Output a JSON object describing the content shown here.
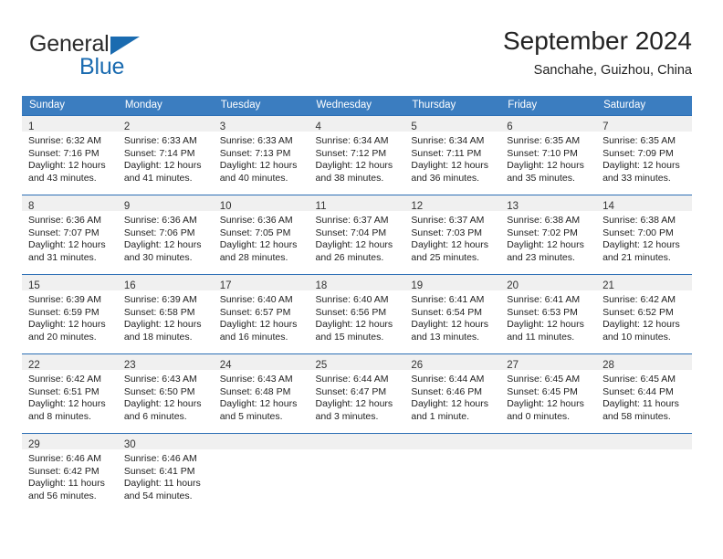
{
  "brand": {
    "name_top": "General",
    "name_bottom": "Blue",
    "accent_color": "#1a6bb0"
  },
  "header": {
    "title": "September 2024",
    "subtitle": "Sanchahe, Guizhou, China"
  },
  "calendar": {
    "header_bg": "#3b7dc0",
    "row_line_color": "#2c6fb5",
    "daynum_bg": "#f0f0f0",
    "weekday_headers": [
      "Sunday",
      "Monday",
      "Tuesday",
      "Wednesday",
      "Thursday",
      "Friday",
      "Saturday"
    ],
    "weeks": [
      [
        {
          "day": "1",
          "lines": [
            "Sunrise: 6:32 AM",
            "Sunset: 7:16 PM",
            "Daylight: 12 hours",
            "and 43 minutes."
          ]
        },
        {
          "day": "2",
          "lines": [
            "Sunrise: 6:33 AM",
            "Sunset: 7:14 PM",
            "Daylight: 12 hours",
            "and 41 minutes."
          ]
        },
        {
          "day": "3",
          "lines": [
            "Sunrise: 6:33 AM",
            "Sunset: 7:13 PM",
            "Daylight: 12 hours",
            "and 40 minutes."
          ]
        },
        {
          "day": "4",
          "lines": [
            "Sunrise: 6:34 AM",
            "Sunset: 7:12 PM",
            "Daylight: 12 hours",
            "and 38 minutes."
          ]
        },
        {
          "day": "5",
          "lines": [
            "Sunrise: 6:34 AM",
            "Sunset: 7:11 PM",
            "Daylight: 12 hours",
            "and 36 minutes."
          ]
        },
        {
          "day": "6",
          "lines": [
            "Sunrise: 6:35 AM",
            "Sunset: 7:10 PM",
            "Daylight: 12 hours",
            "and 35 minutes."
          ]
        },
        {
          "day": "7",
          "lines": [
            "Sunrise: 6:35 AM",
            "Sunset: 7:09 PM",
            "Daylight: 12 hours",
            "and 33 minutes."
          ]
        }
      ],
      [
        {
          "day": "8",
          "lines": [
            "Sunrise: 6:36 AM",
            "Sunset: 7:07 PM",
            "Daylight: 12 hours",
            "and 31 minutes."
          ]
        },
        {
          "day": "9",
          "lines": [
            "Sunrise: 6:36 AM",
            "Sunset: 7:06 PM",
            "Daylight: 12 hours",
            "and 30 minutes."
          ]
        },
        {
          "day": "10",
          "lines": [
            "Sunrise: 6:36 AM",
            "Sunset: 7:05 PM",
            "Daylight: 12 hours",
            "and 28 minutes."
          ]
        },
        {
          "day": "11",
          "lines": [
            "Sunrise: 6:37 AM",
            "Sunset: 7:04 PM",
            "Daylight: 12 hours",
            "and 26 minutes."
          ]
        },
        {
          "day": "12",
          "lines": [
            "Sunrise: 6:37 AM",
            "Sunset: 7:03 PM",
            "Daylight: 12 hours",
            "and 25 minutes."
          ]
        },
        {
          "day": "13",
          "lines": [
            "Sunrise: 6:38 AM",
            "Sunset: 7:02 PM",
            "Daylight: 12 hours",
            "and 23 minutes."
          ]
        },
        {
          "day": "14",
          "lines": [
            "Sunrise: 6:38 AM",
            "Sunset: 7:00 PM",
            "Daylight: 12 hours",
            "and 21 minutes."
          ]
        }
      ],
      [
        {
          "day": "15",
          "lines": [
            "Sunrise: 6:39 AM",
            "Sunset: 6:59 PM",
            "Daylight: 12 hours",
            "and 20 minutes."
          ]
        },
        {
          "day": "16",
          "lines": [
            "Sunrise: 6:39 AM",
            "Sunset: 6:58 PM",
            "Daylight: 12 hours",
            "and 18 minutes."
          ]
        },
        {
          "day": "17",
          "lines": [
            "Sunrise: 6:40 AM",
            "Sunset: 6:57 PM",
            "Daylight: 12 hours",
            "and 16 minutes."
          ]
        },
        {
          "day": "18",
          "lines": [
            "Sunrise: 6:40 AM",
            "Sunset: 6:56 PM",
            "Daylight: 12 hours",
            "and 15 minutes."
          ]
        },
        {
          "day": "19",
          "lines": [
            "Sunrise: 6:41 AM",
            "Sunset: 6:54 PM",
            "Daylight: 12 hours",
            "and 13 minutes."
          ]
        },
        {
          "day": "20",
          "lines": [
            "Sunrise: 6:41 AM",
            "Sunset: 6:53 PM",
            "Daylight: 12 hours",
            "and 11 minutes."
          ]
        },
        {
          "day": "21",
          "lines": [
            "Sunrise: 6:42 AM",
            "Sunset: 6:52 PM",
            "Daylight: 12 hours",
            "and 10 minutes."
          ]
        }
      ],
      [
        {
          "day": "22",
          "lines": [
            "Sunrise: 6:42 AM",
            "Sunset: 6:51 PM",
            "Daylight: 12 hours",
            "and 8 minutes."
          ]
        },
        {
          "day": "23",
          "lines": [
            "Sunrise: 6:43 AM",
            "Sunset: 6:50 PM",
            "Daylight: 12 hours",
            "and 6 minutes."
          ]
        },
        {
          "day": "24",
          "lines": [
            "Sunrise: 6:43 AM",
            "Sunset: 6:48 PM",
            "Daylight: 12 hours",
            "and 5 minutes."
          ]
        },
        {
          "day": "25",
          "lines": [
            "Sunrise: 6:44 AM",
            "Sunset: 6:47 PM",
            "Daylight: 12 hours",
            "and 3 minutes."
          ]
        },
        {
          "day": "26",
          "lines": [
            "Sunrise: 6:44 AM",
            "Sunset: 6:46 PM",
            "Daylight: 12 hours",
            "and 1 minute."
          ]
        },
        {
          "day": "27",
          "lines": [
            "Sunrise: 6:45 AM",
            "Sunset: 6:45 PM",
            "Daylight: 12 hours",
            "and 0 minutes."
          ]
        },
        {
          "day": "28",
          "lines": [
            "Sunrise: 6:45 AM",
            "Sunset: 6:44 PM",
            "Daylight: 11 hours",
            "and 58 minutes."
          ]
        }
      ],
      [
        {
          "day": "29",
          "lines": [
            "Sunrise: 6:46 AM",
            "Sunset: 6:42 PM",
            "Daylight: 11 hours",
            "and 56 minutes."
          ]
        },
        {
          "day": "30",
          "lines": [
            "Sunrise: 6:46 AM",
            "Sunset: 6:41 PM",
            "Daylight: 11 hours",
            "and 54 minutes."
          ]
        },
        {
          "day": "",
          "lines": []
        },
        {
          "day": "",
          "lines": []
        },
        {
          "day": "",
          "lines": []
        },
        {
          "day": "",
          "lines": []
        },
        {
          "day": "",
          "lines": []
        }
      ]
    ]
  }
}
